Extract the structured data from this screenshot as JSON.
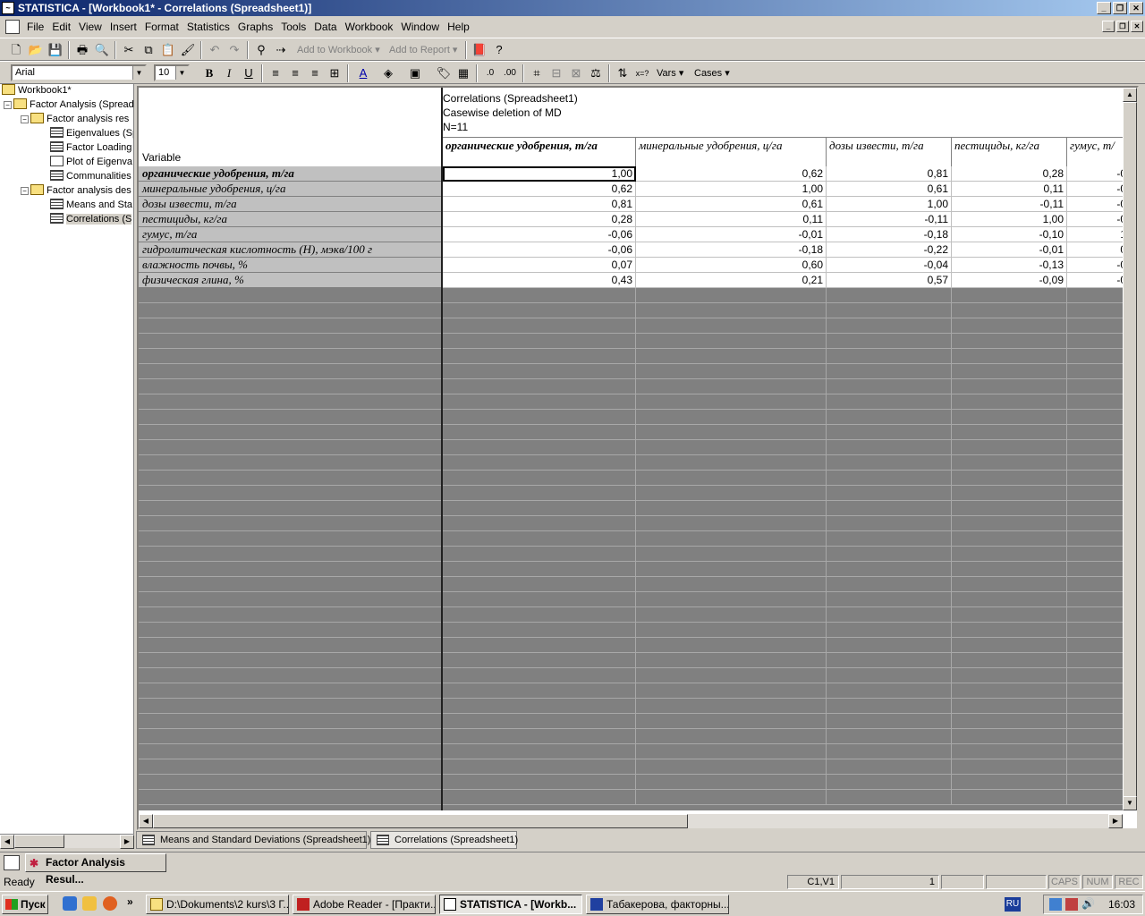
{
  "window": {
    "title": "STATISTICA - [Workbook1* - Correlations (Spreadsheet1)]"
  },
  "menu": [
    "File",
    "Edit",
    "View",
    "Insert",
    "Format",
    "Statistics",
    "Graphs",
    "Tools",
    "Data",
    "Workbook",
    "Window",
    "Help"
  ],
  "toolbar": {
    "add_to_workbook": "Add to Workbook",
    "add_to_report": "Add to Report",
    "font": "Arial",
    "size": "10",
    "vars": "Vars",
    "cases": "Cases"
  },
  "tree": {
    "root": "Workbook1*",
    "items": [
      {
        "label": "Factor Analysis (Spread"
      },
      {
        "label": "Factor analysis res"
      },
      {
        "label": "Eigenvalues (Sp"
      },
      {
        "label": "Factor Loading"
      },
      {
        "label": "Plot of Eigenva"
      },
      {
        "label": "Communalities"
      },
      {
        "label": "Factor analysis des"
      },
      {
        "label": "Means and Sta"
      },
      {
        "label": "Correlations (S"
      }
    ]
  },
  "sheet": {
    "header_lines": [
      "Correlations (Spreadsheet1)",
      "Casewise deletion of MD",
      "N=11"
    ],
    "variable_caption": "Variable",
    "columns": [
      "органические удобрения, т/га",
      "минеральные удобрения, ц/га",
      "дозы извести, т/га",
      "пестициды, кг/га",
      "гумус, т/"
    ],
    "rows": [
      {
        "label": "органические удобрения, т/га",
        "values": [
          "1,00",
          "0,62",
          "0,81",
          "0,28",
          "-0"
        ]
      },
      {
        "label": "минеральные удобрения, ц/га",
        "values": [
          "0,62",
          "1,00",
          "0,61",
          "0,11",
          "-0"
        ]
      },
      {
        "label": "дозы извести, т/га",
        "values": [
          "0,81",
          "0,61",
          "1,00",
          "-0,11",
          "-0"
        ]
      },
      {
        "label": "пестициды, кг/га",
        "values": [
          "0,28",
          "0,11",
          "-0,11",
          "1,00",
          "-0"
        ]
      },
      {
        "label": "гумус, т/га",
        "values": [
          "-0,06",
          "-0,01",
          "-0,18",
          "-0,10",
          "1"
        ]
      },
      {
        "label": "гидролитическая кислотность (Н), мэкв/100 г",
        "values": [
          "-0,06",
          "-0,18",
          "-0,22",
          "-0,01",
          "0"
        ]
      },
      {
        "label": "влажность почвы, %",
        "values": [
          "0,07",
          "0,60",
          "-0,04",
          "-0,13",
          "-0"
        ]
      },
      {
        "label": "физическая глина, %",
        "values": [
          "0,43",
          "0,21",
          "0,57",
          "-0,09",
          "-0"
        ]
      }
    ]
  },
  "tabs": [
    "Means and Standard Deviations (Spreadsheet1)",
    "Correlations (Spreadsheet1)"
  ],
  "strip": {
    "task": "Factor Analysis Resul..."
  },
  "status": {
    "ready": "Ready",
    "cell": "C1,V1",
    "value": "1",
    "caps": "CAPS",
    "num": "NUM",
    "rec": "REC"
  },
  "taskbar": {
    "start": "Пуск",
    "tasks": [
      "D:\\Dokuments\\2 kurs\\3 Г...",
      "Adobe Reader - [Практи...",
      "STATISTICA - [Workb...",
      "Табакерова, факторны..."
    ],
    "lang": "RU",
    "clock": "16:03"
  }
}
